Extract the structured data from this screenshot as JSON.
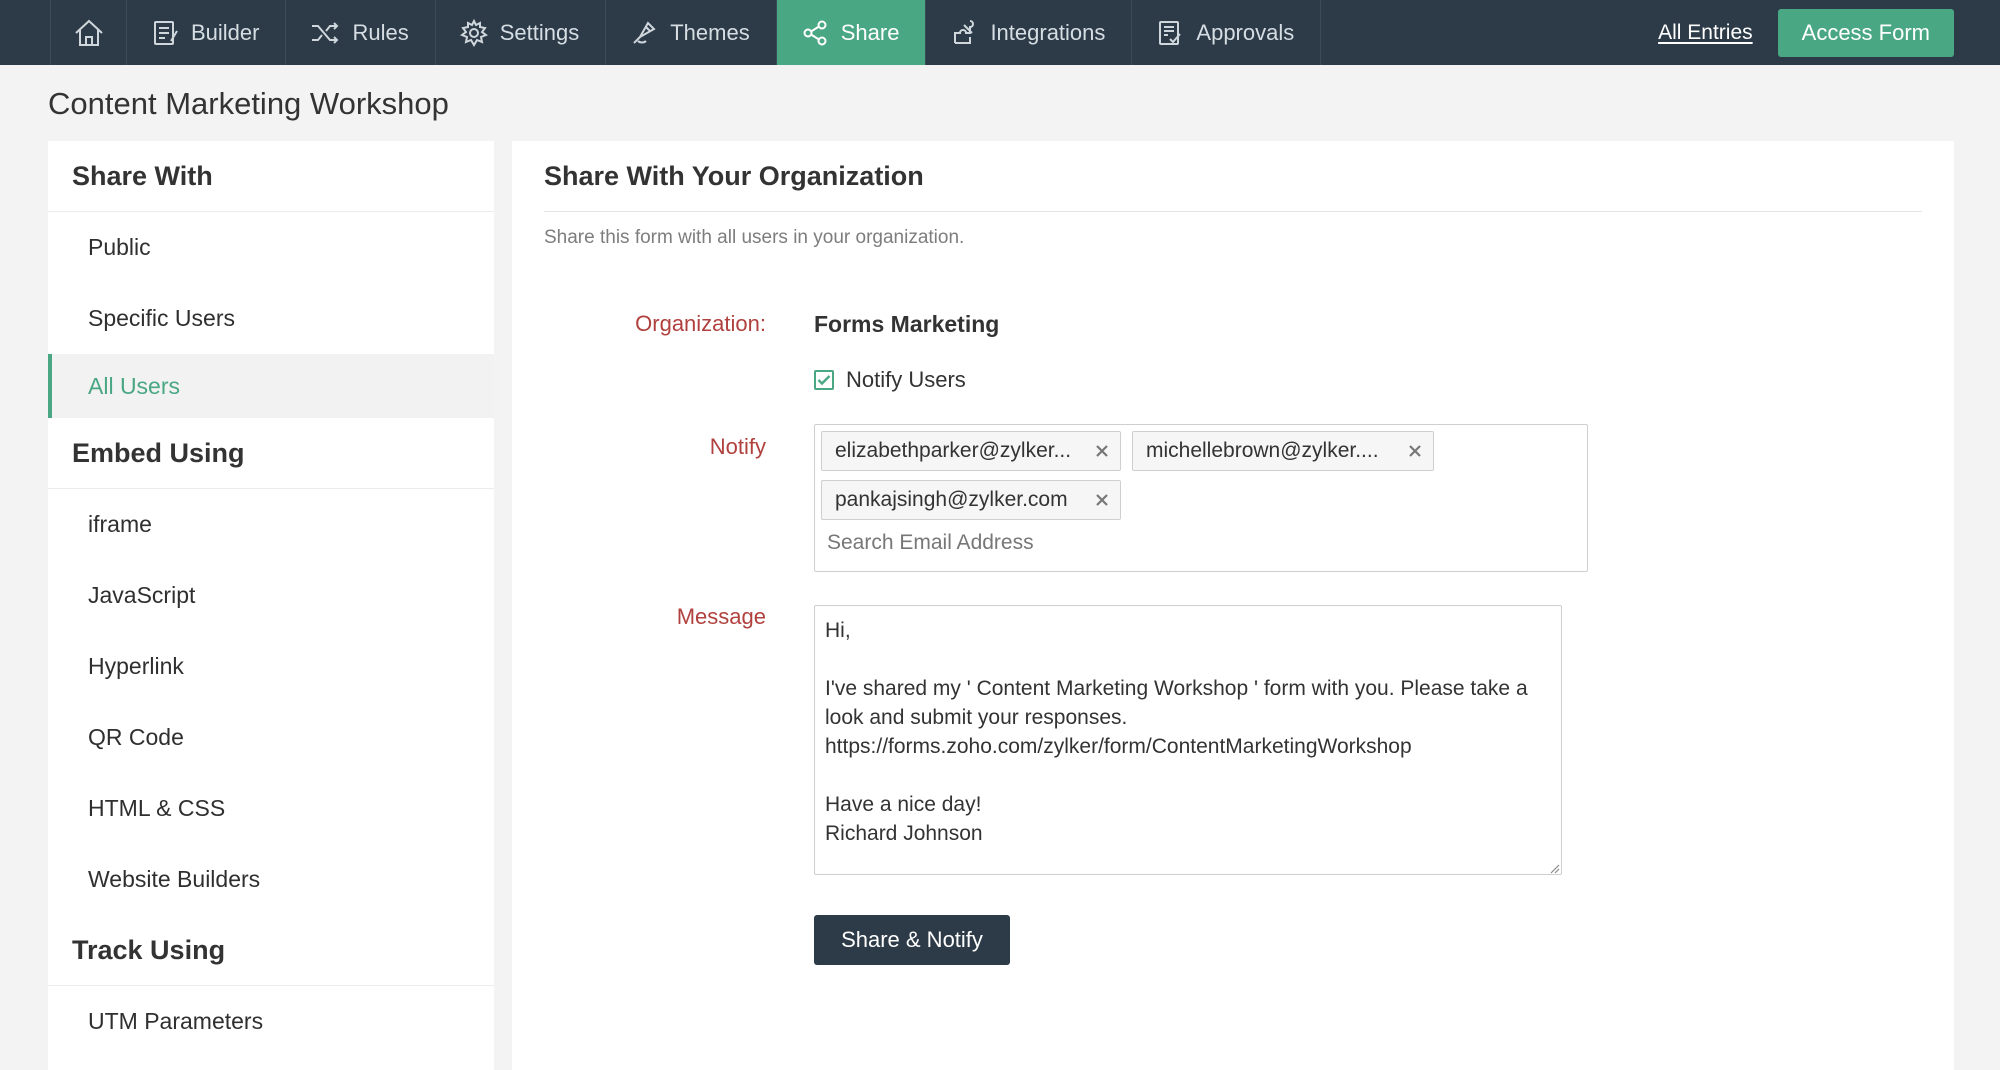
{
  "nav": {
    "items": [
      {
        "label": "Builder",
        "icon": "builder-icon"
      },
      {
        "label": "Rules",
        "icon": "shuffle-icon"
      },
      {
        "label": "Settings",
        "icon": "gear-icon"
      },
      {
        "label": "Themes",
        "icon": "paint-icon"
      },
      {
        "label": "Share",
        "icon": "share-icon",
        "active": true
      },
      {
        "label": "Integrations",
        "icon": "puzzle-icon"
      },
      {
        "label": "Approvals",
        "icon": "approvals-icon"
      }
    ],
    "all_entries": "All Entries",
    "access_form": "Access Form"
  },
  "page_title": "Content Marketing Workshop",
  "sidebar": {
    "share_with": {
      "heading": "Share With",
      "items": [
        "Public",
        "Specific Users",
        "All Users"
      ],
      "active": "All Users"
    },
    "embed_using": {
      "heading": "Embed Using",
      "items": [
        "iframe",
        "JavaScript",
        "Hyperlink",
        "QR Code",
        "HTML & CSS",
        "Website Builders"
      ]
    },
    "track_using": {
      "heading": "Track Using",
      "items": [
        "UTM Parameters"
      ]
    }
  },
  "main": {
    "title": "Share With Your Organization",
    "description": "Share this form with all users in your organization.",
    "organization_label": "Organization:",
    "organization_value": "Forms Marketing",
    "notify_users_label": "Notify Users",
    "notify_users_checked": true,
    "notify_label": "Notify",
    "recipients": [
      "elizabethparker@zylker...",
      "michellebrown@zylker....",
      "pankajsingh@zylker.com"
    ],
    "search_placeholder": "Search Email Address",
    "message_label": "Message",
    "message": "Hi,\n\nI've shared my ' Content Marketing Workshop ' form with you. Please take a look and submit your responses.\nhttps://forms.zoho.com/zylker/form/ContentMarketingWorkshop\n\nHave a nice day!\nRichard Johnson",
    "share_button": "Share & Notify"
  },
  "colors": {
    "nav_bg": "#2c3b47",
    "accent": "#4aa783",
    "label_red": "#b0413e"
  }
}
